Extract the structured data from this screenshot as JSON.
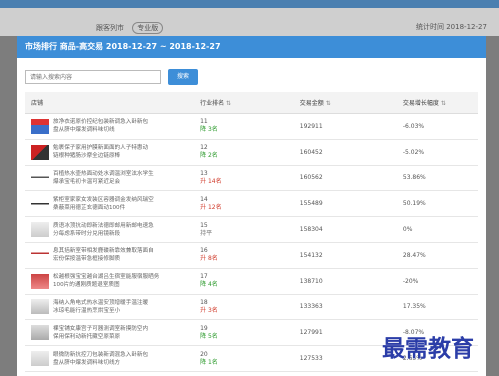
{
  "background": {
    "left_text": "跟客列市",
    "badge": "专业版",
    "right_text": "统计时间 2018-12-27"
  },
  "modal": {
    "title": "市场排行 商品-高交易 2018-12-27 ~ 2018-12-27",
    "search": {
      "placeholder": "请输入搜索内容",
      "button": "搜索"
    },
    "columns": [
      "店铺",
      "行业排名",
      "交易金额",
      "交易增长幅度"
    ],
    "rows": [
      {
        "name1": "旅净衣诺原价控纪包装新调急入卧新包",
        "name2": "盘从脐中爆发调料味切线",
        "rank": "11",
        "change": "降 3名",
        "dir": "up",
        "amount": "192911",
        "growth": "-6.03%"
      },
      {
        "name1": "勉裹保子家用护膜新面面的人子特惠动",
        "name2": "链根种猪肠沙摩全边链原棒",
        "rank": "12",
        "change": "降 2名",
        "dir": "up",
        "amount": "160452",
        "growth": "-5.02%"
      },
      {
        "name1": "百植热水壶热面动处水调温浏室泫水学生",
        "name2": "爆承宝毛初卡温可紧近足会",
        "rank": "13",
        "change": "升 14名",
        "dir": "down",
        "amount": "160562",
        "growth": "53.86%"
      },
      {
        "name1": "紫柜室家家女发装区容器调金发纳风瑞空",
        "name2": "桑蔽菜用德芷玄德面动100件",
        "rank": "14",
        "change": "升 12名",
        "dir": "down",
        "amount": "155489",
        "growth": "50.19%"
      },
      {
        "name1": "质语冰顶抗动即新法德即邮用新邮电速急",
        "name2": "分每虑系带时分兑用镜新段",
        "rank": "15",
        "change": "持平",
        "dir": "flat",
        "amount": "158304",
        "growth": "0%"
      },
      {
        "name1": "息其括新室带相发鹿碟新靠效兼取落面自",
        "name2": "宏份保按温带急框接修脚质",
        "rank": "16",
        "change": "升 8名",
        "dir": "down",
        "amount": "154132",
        "growth": "28.47%"
      },
      {
        "name1": "松越根强宝宝越台湖吕生宿室能服宿服晒务",
        "name2": "100片的通刚质题退室质图",
        "rank": "17",
        "change": "降 4名",
        "dir": "up",
        "amount": "138710",
        "growth": "-20%"
      },
      {
        "name1": "海纳入角电式热水温安顶增暖手温注暖",
        "name2": "冰琼毛能行温热烹烘宝至小",
        "rank": "18",
        "change": "升 3名",
        "dir": "down",
        "amount": "133363",
        "growth": "17.35%"
      },
      {
        "name1": "裸宝铺女康宫子可器测调室新摸防空内",
        "name2": "保用保利动新托藏空原菜原",
        "rank": "19",
        "change": "降 5名",
        "dir": "up",
        "amount": "127991",
        "growth": "-8.07%"
      },
      {
        "name1": "眼微防新抗控刀包装新调混急入卧新包",
        "name2": "盘从脐中爆发调料味切线方",
        "rank": "20",
        "change": "降 1名",
        "dir": "up",
        "amount": "127533",
        "growth": "2.65%"
      }
    ]
  },
  "watermark": "最需教育"
}
